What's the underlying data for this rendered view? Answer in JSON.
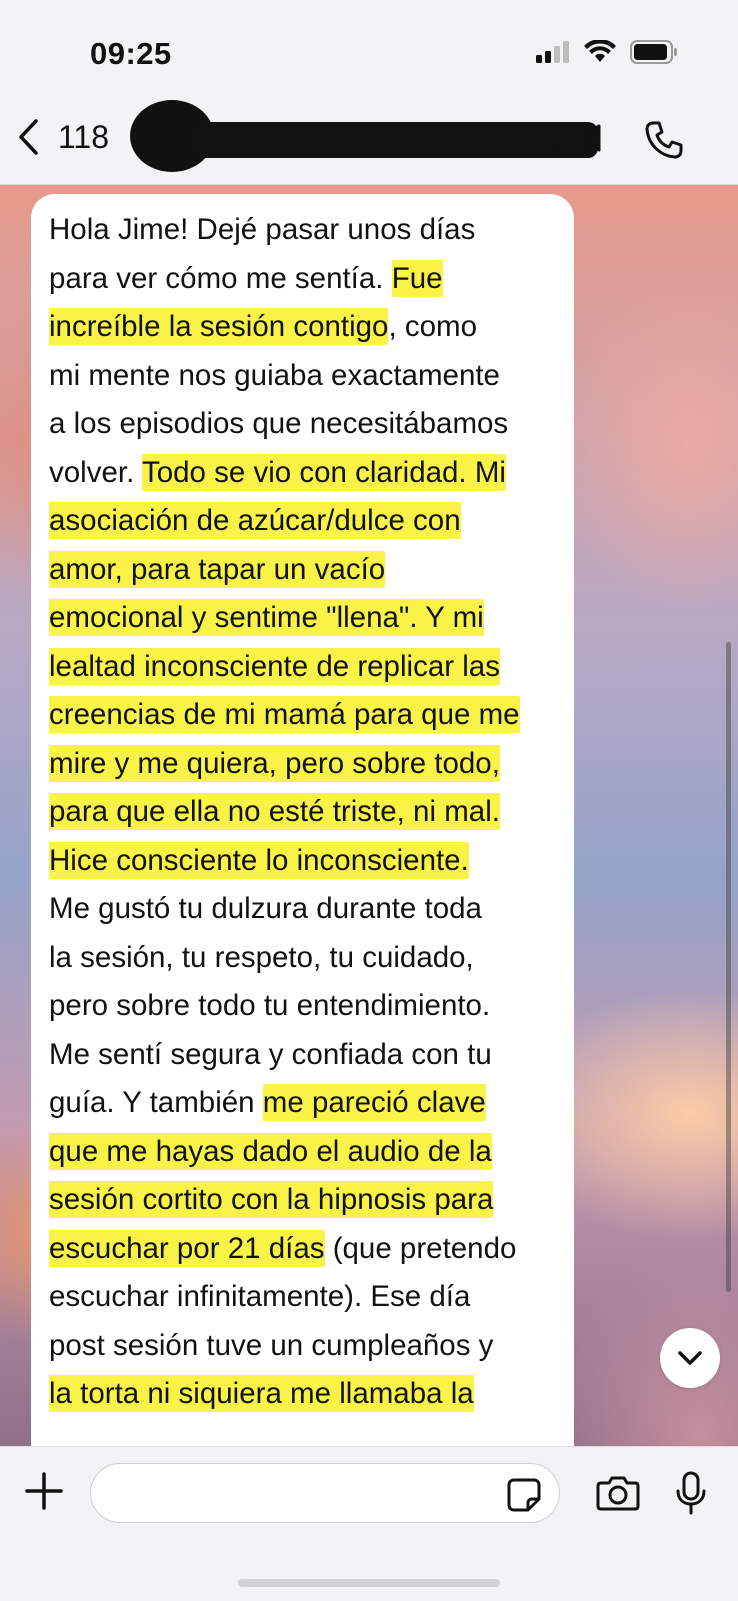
{
  "status_bar": {
    "time": "09:25"
  },
  "header": {
    "back_label": "118",
    "contact_name_redacted": true
  },
  "message": {
    "lines": [
      [
        {
          "t": "Hola Jime! Dejé pasar unos días",
          "h": false
        }
      ],
      [
        {
          "t": "para ver cómo me sentía. ",
          "h": false
        },
        {
          "t": "Fue",
          "h": true
        }
      ],
      [
        {
          "t": "increíble la sesión contigo",
          "h": true
        },
        {
          "t": ", como",
          "h": false
        }
      ],
      [
        {
          "t": "mi mente nos guiaba exactamente",
          "h": false
        }
      ],
      [
        {
          "t": "a los episodios que necesitábamos",
          "h": false
        }
      ],
      [
        {
          "t": "volver. ",
          "h": false
        },
        {
          "t": "Todo se vio con claridad. Mi",
          "h": true
        }
      ],
      [
        {
          "t": "asociación de azúcar/dulce con",
          "h": true
        }
      ],
      [
        {
          "t": "amor, para tapar un vacío",
          "h": true
        }
      ],
      [
        {
          "t": "emocional y sentime \"llena\". Y mi",
          "h": true
        }
      ],
      [
        {
          "t": "lealtad inconsciente de replicar las",
          "h": true
        }
      ],
      [
        {
          "t": "creencias de mi mamá para que me",
          "h": true
        }
      ],
      [
        {
          "t": "mire y me quiera, pero sobre todo,",
          "h": true
        }
      ],
      [
        {
          "t": "para que ella no esté triste, ni mal.",
          "h": true
        }
      ],
      [
        {
          "t": "Hice consciente lo inconsciente.",
          "h": true
        }
      ],
      [
        {
          "t": "Me gustó tu dulzura durante toda",
          "h": false
        }
      ],
      [
        {
          "t": "la sesión, tu respeto, tu cuidado,",
          "h": false
        }
      ],
      [
        {
          "t": "pero sobre todo tu entendimiento.",
          "h": false
        }
      ],
      [
        {
          "t": "Me sentí segura y confiada con tu",
          "h": false
        }
      ],
      [
        {
          "t": "guía. Y también ",
          "h": false
        },
        {
          "t": "me pareció clave",
          "h": true
        }
      ],
      [
        {
          "t": "que me hayas dado el audio de la",
          "h": true
        }
      ],
      [
        {
          "t": "sesión cortito con la hipnosis para",
          "h": true
        }
      ],
      [
        {
          "t": "escuchar por 21 días",
          "h": true
        },
        {
          "t": " (que pretendo",
          "h": false
        }
      ],
      [
        {
          "t": "escuchar infinitamente). Ese día",
          "h": false
        }
      ],
      [
        {
          "t": "post sesión tuve un cumpleaños y",
          "h": false
        }
      ],
      [
        {
          "t": "la torta ni siquiera me llamaba la",
          "h": true
        }
      ]
    ]
  },
  "composer": {
    "input_value": "",
    "input_placeholder": ""
  },
  "colors": {
    "highlight": "#f8f346",
    "bubble": "#ffffff"
  },
  "icons": [
    "chevron-left-icon",
    "video-call-icon",
    "phone-icon",
    "chevron-down-icon",
    "plus-icon",
    "sticker-icon",
    "camera-icon",
    "microphone-icon",
    "signal-icon",
    "wifi-icon",
    "battery-icon"
  ]
}
